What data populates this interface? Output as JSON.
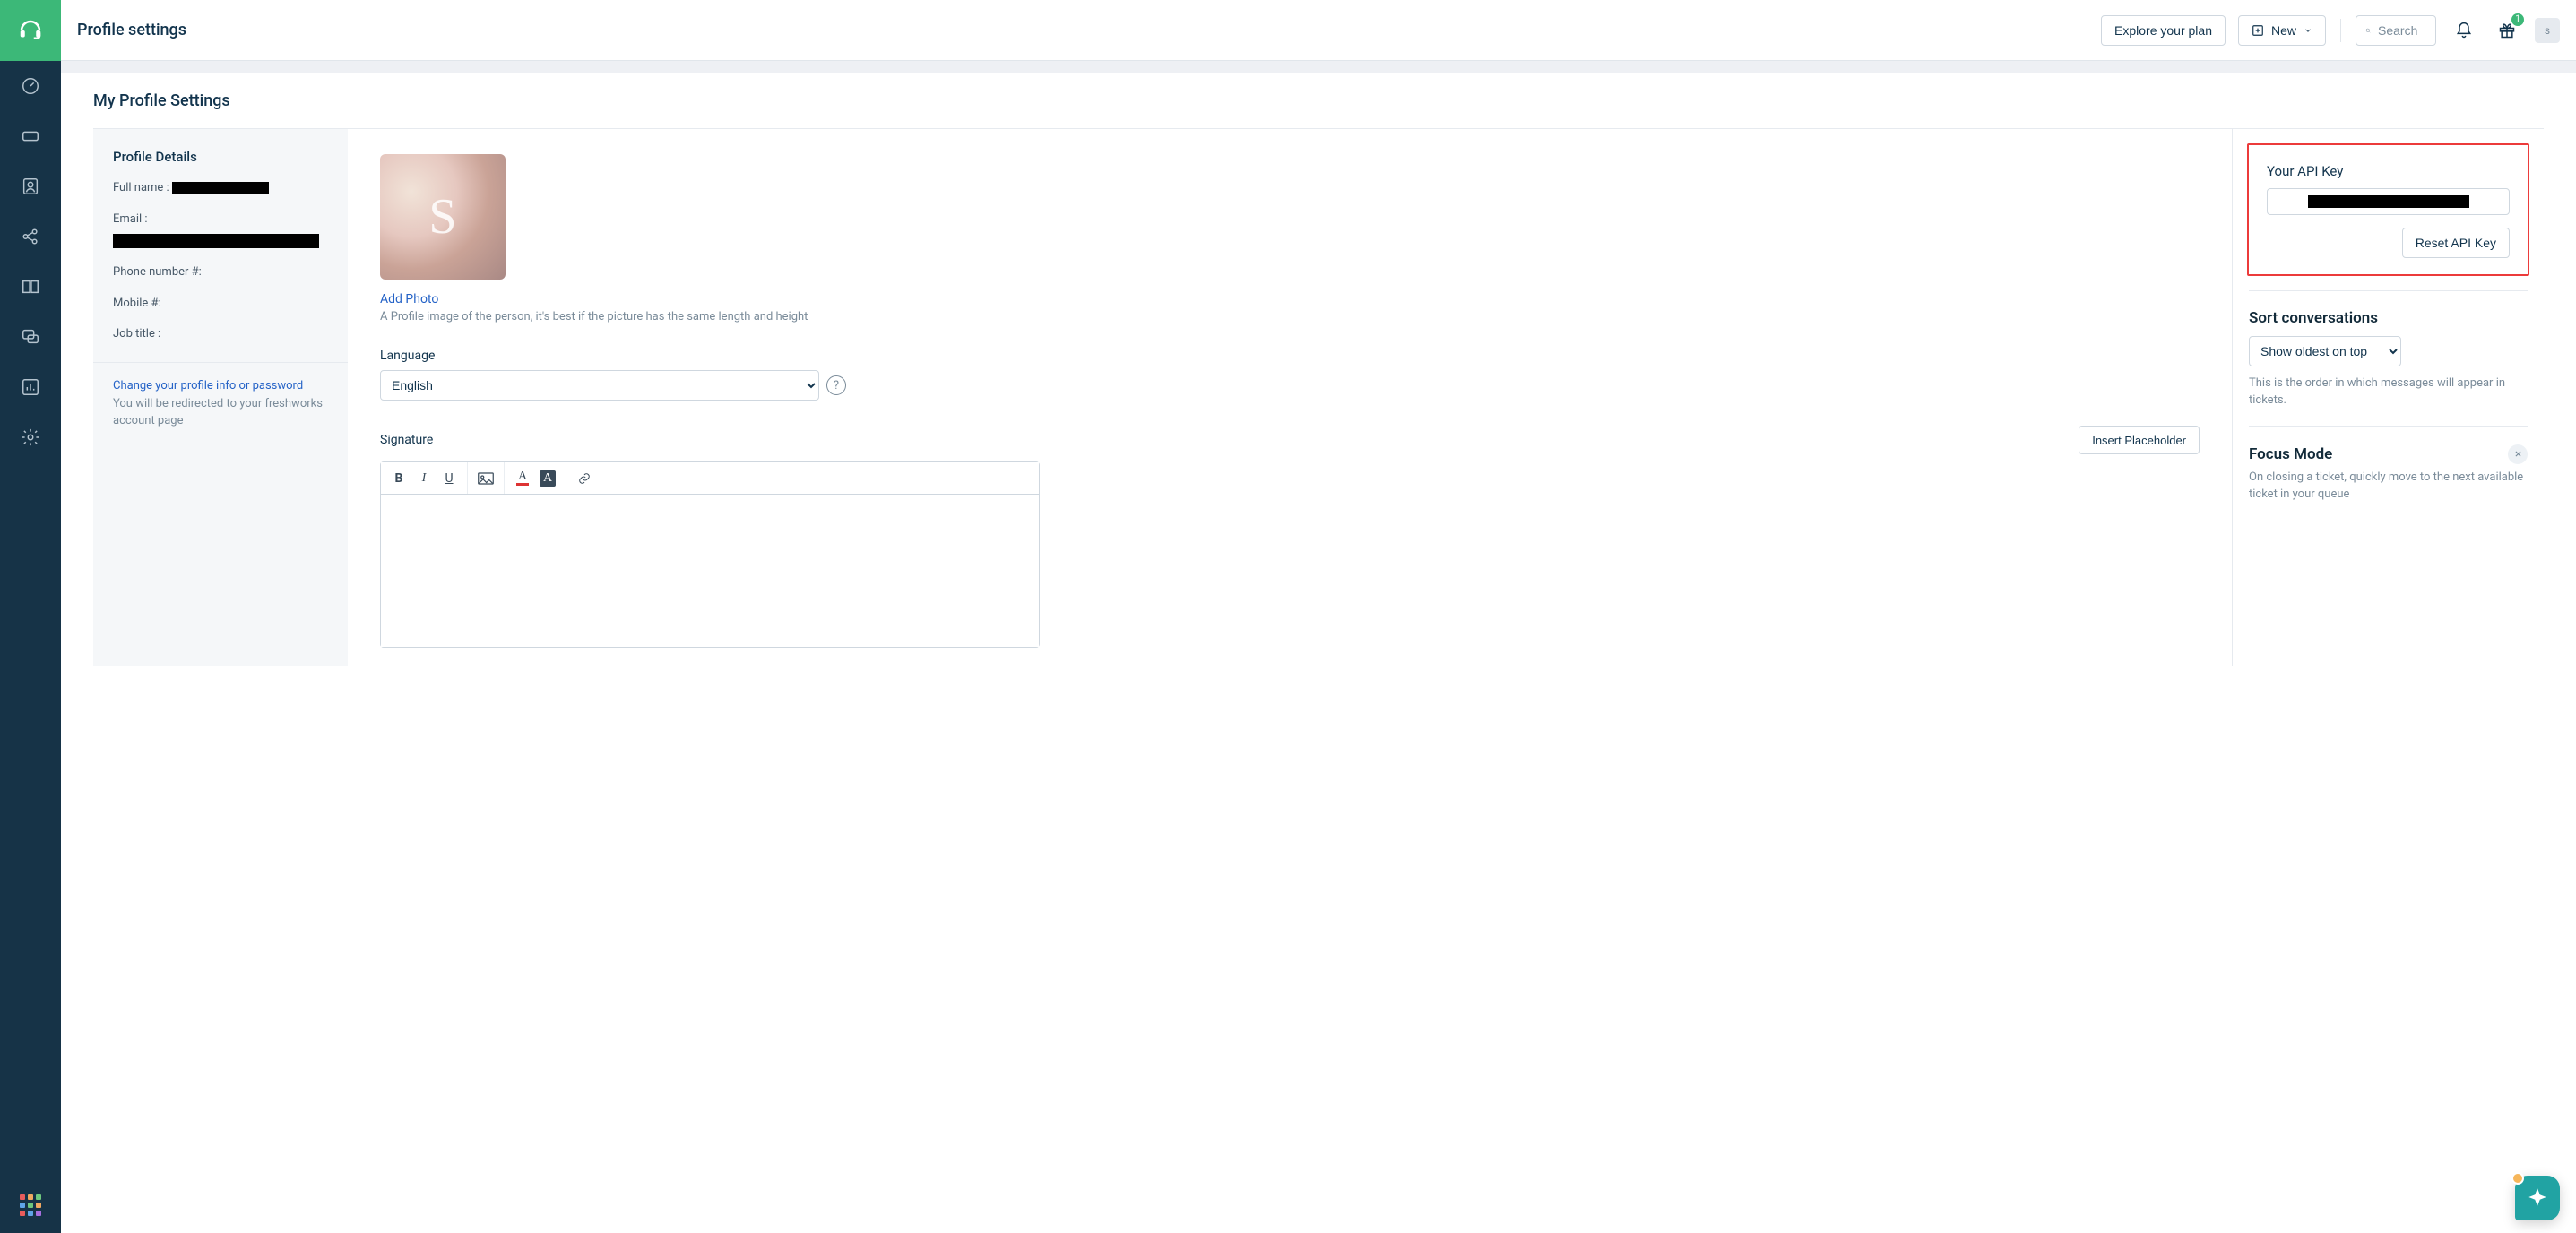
{
  "header": {
    "page_title": "Profile settings",
    "explore_label": "Explore your plan",
    "new_label": "New",
    "search_placeholder": "Search",
    "gift_badge": "1",
    "avatar_initial": "s"
  },
  "sidebar": {
    "items": [
      {
        "name": "dashboard"
      },
      {
        "name": "tickets"
      },
      {
        "name": "contacts"
      },
      {
        "name": "social"
      },
      {
        "name": "solutions"
      },
      {
        "name": "forums"
      },
      {
        "name": "reports"
      },
      {
        "name": "settings"
      }
    ],
    "launcher_name": "app-launcher"
  },
  "page": {
    "title": "My Profile Settings",
    "profile_details": {
      "section_title": "Profile Details",
      "full_name_label": "Full name :",
      "email_label": "Email :",
      "phone_label": "Phone number #:",
      "mobile_label": "Mobile #:",
      "job_title_label": "Job title :"
    },
    "change_link": "Change your profile info or password",
    "change_hint": "You will be redirected to your freshworks account page",
    "avatar_letter": "S",
    "add_photo_label": "Add Photo",
    "add_photo_hint": "A Profile image of the person, it's best if the picture has the same length and height",
    "language_label": "Language",
    "language_value": "English",
    "signature_label": "Signature",
    "insert_placeholder_label": "Insert Placeholder"
  },
  "right": {
    "api": {
      "title": "Your API Key",
      "reset_label": "Reset API Key"
    },
    "sort": {
      "title": "Sort conversations",
      "value": "Show oldest on top",
      "hint": "This is the order in which messages will appear in tickets."
    },
    "focus": {
      "title": "Focus Mode",
      "hint": "On closing a ticket, quickly move to the next available ticket in your queue"
    }
  }
}
